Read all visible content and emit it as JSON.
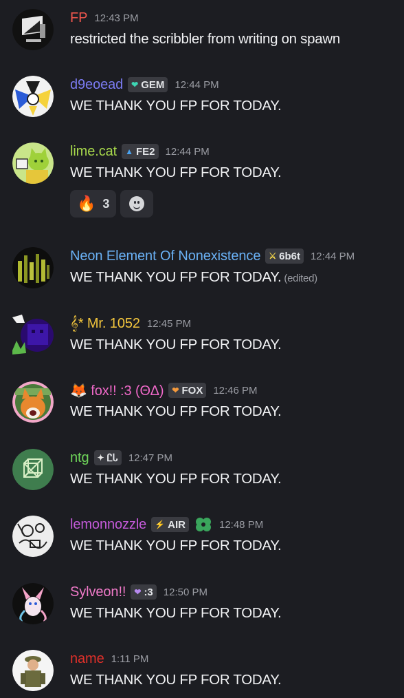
{
  "messages": [
    {
      "author": "FP",
      "color": "#f0564d",
      "time": "12:43 PM",
      "text": "restricted the scribbler from writing on spawn",
      "avatar": "monitor-avatar"
    },
    {
      "author": "d9eoead",
      "color": "#7b7bf2",
      "tag": {
        "icon": "heart-icon",
        "label": "GEM",
        "icon_color": "#3dd6b4"
      },
      "time": "12:44 PM",
      "text": "WE THANK YOU FP FOR TODAY.",
      "avatar": "cartoon-avatar"
    },
    {
      "author": "lime.cat",
      "color": "#a8d94c",
      "tag": {
        "icon": "drop-icon",
        "label": "FE2",
        "icon_color": "#4aa3f0"
      },
      "time": "12:44 PM",
      "text": "WE THANK YOU FP FOR TODAY.",
      "avatar": "lime-cat-avatar",
      "reactions": [
        {
          "emoji": "🔥",
          "count": "3"
        }
      ]
    },
    {
      "author": "Neon Element Of Nonexistence",
      "color": "#6ab1f5",
      "tag": {
        "icon": "sword-icon",
        "label": "6b6t",
        "icon_color": "#f0d24a"
      },
      "time": "12:44 PM",
      "text": "WE THANK YOU FP FOR TODAY.",
      "edited": "(edited)",
      "avatar": "neon-avatar"
    },
    {
      "author": "𝄞* Mr. 1052",
      "color": "#f2c53d",
      "time": "12:45 PM",
      "text": "WE THANK YOU FP FOR TODAY.",
      "avatar": "purple-blob-avatar"
    },
    {
      "author": "🦊 fox!! :3  (ΘΔ)",
      "color": "#f069c9",
      "tag": {
        "icon": "heart-icon",
        "label": "FOX",
        "icon_color": "#f59a3c"
      },
      "time": "12:46 PM",
      "text": "WE THANK YOU FP FOR TODAY.",
      "avatar": "fox-avatar"
    },
    {
      "author": "ntg",
      "color": "#6fd65a",
      "tag": {
        "icon": "sparkle-icon",
        "label": "ᏝᏓ",
        "icon_color": "#e8e8e8"
      },
      "time": "12:47 PM",
      "text": "WE THANK YOU FP FOR TODAY.",
      "avatar": "cube-avatar"
    },
    {
      "author": "lemonnozzle",
      "color": "#c45ad9",
      "tag": {
        "icon": "bolt-icon",
        "label": "AIR",
        "icon_color": "#f04b5a"
      },
      "time": "12:48 PM",
      "text": "WE THANK YOU FP FOR TODAY.",
      "avatar": "sketch-avatar",
      "extra_icon": "clover-icon"
    },
    {
      "author": "Sylveon!!",
      "color": "#f07ac9",
      "tag": {
        "icon": "heart-icon",
        "label": ":3",
        "icon_color": "#b78af0"
      },
      "time": "12:50 PM",
      "text": "WE THANK YOU FP FOR TODAY.",
      "avatar": "sylveon-avatar"
    },
    {
      "author": "name",
      "color": "#e0302a",
      "time": "1:11 PM",
      "text": "WE THANK YOU FP FOR TODAY.",
      "avatar": "soldier-avatar"
    }
  ]
}
